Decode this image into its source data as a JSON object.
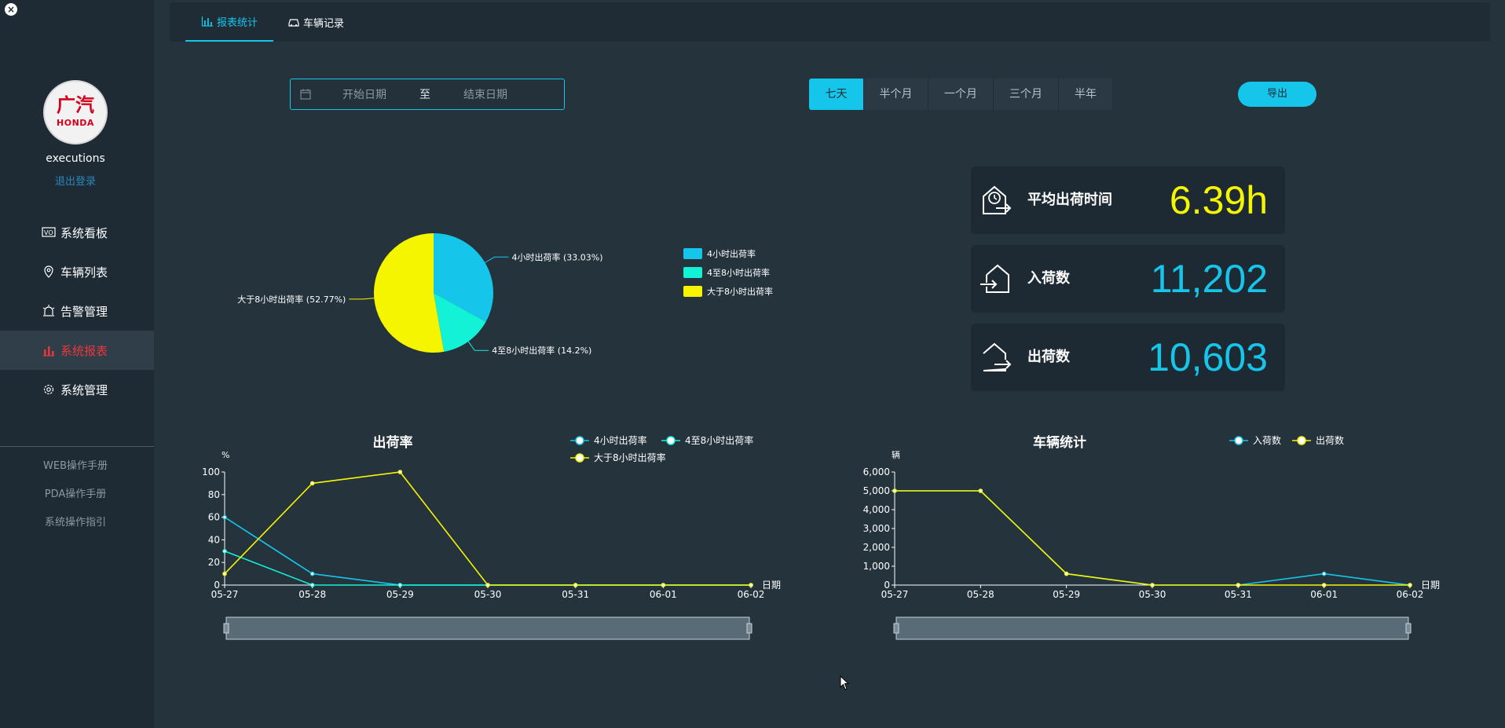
{
  "sidebar": {
    "username": "executions",
    "logout": "退出登录",
    "avatar_logo_top": "广汽",
    "avatar_logo_bottom": "HONDA",
    "menu": [
      {
        "label": "系统看板",
        "icon": "dashboard-icon",
        "active": false
      },
      {
        "label": "车辆列表",
        "icon": "map-pin-icon",
        "active": false
      },
      {
        "label": "告警管理",
        "icon": "alarm-icon",
        "active": false
      },
      {
        "label": "系统报表",
        "icon": "report-icon",
        "active": true
      },
      {
        "label": "系统管理",
        "icon": "gear-icon",
        "active": false
      }
    ],
    "helper_links": [
      "WEB操作手册",
      "PDA操作手册",
      "系统操作指引"
    ]
  },
  "tabs": [
    {
      "label": "报表统计",
      "icon": "bar-chart-icon",
      "active": true
    },
    {
      "label": "车辆记录",
      "icon": "car-icon",
      "active": false
    }
  ],
  "filters": {
    "start_placeholder": "开始日期",
    "separator": "至",
    "end_placeholder": "结束日期",
    "ranges": [
      "七天",
      "半个月",
      "一个月",
      "三个月",
      "半年"
    ],
    "active_range": "七天",
    "export_label": "导出"
  },
  "stats": [
    {
      "label": "平均出荷时间",
      "value": "6.39h",
      "color": "#f5f500",
      "icon": "clock-export-icon"
    },
    {
      "label": "入荷数",
      "value": "11,202",
      "color": "#16c6ea",
      "icon": "inbound-house-icon"
    },
    {
      "label": "出荷数",
      "value": "10,603",
      "color": "#16c6ea",
      "icon": "outbound-house-icon"
    }
  ],
  "colors": {
    "accent": "#16c6ea",
    "series_4h": "#16c6ea",
    "series_4to8h": "#13f1d7",
    "series_8h": "#f5f500",
    "active_menu": "#e8383d"
  },
  "chart_data": [
    {
      "type": "pie",
      "slices": [
        {
          "name": "4小时出荷率",
          "value": 33.03,
          "label": "4小时出荷率 (33.03%)",
          "color": "#16c6ea"
        },
        {
          "name": "4至8小时出荷率",
          "value": 14.2,
          "label": "4至8小时出荷率 (14.2%)",
          "color": "#13f1d7"
        },
        {
          "name": "大于8小时出荷率",
          "value": 52.77,
          "label": "大于8小时出荷率 (52.77%)",
          "color": "#f5f500"
        }
      ],
      "legend": [
        "4小时出荷率",
        "4至8小时出荷率",
        "大于8小时出荷率"
      ],
      "legend_position": "right"
    },
    {
      "type": "line",
      "title": "出荷率",
      "ylabel": "%",
      "xlabel": "日期",
      "ylim": [
        0,
        100
      ],
      "yticks": [
        "0",
        "20",
        "40",
        "60",
        "80",
        "100"
      ],
      "ytick_values": [
        0,
        20,
        40,
        60,
        80,
        100
      ],
      "categories": [
        "05-27",
        "05-28",
        "05-29",
        "05-30",
        "05-31",
        "06-01",
        "06-02"
      ],
      "series": [
        {
          "name": "4小时出荷率",
          "color": "#16c6ea",
          "values": [
            60,
            10,
            0,
            0,
            0,
            0,
            0
          ]
        },
        {
          "name": "4至8小时出荷率",
          "color": "#13f1d7",
          "values": [
            30,
            0,
            0,
            0,
            0,
            0,
            0
          ]
        },
        {
          "name": "大于8小时出荷率",
          "color": "#f5f500",
          "values": [
            10,
            90,
            100,
            0,
            0,
            0,
            0
          ]
        }
      ],
      "legend_position": "top-right"
    },
    {
      "type": "line",
      "title": "车辆统计",
      "ylabel": "辆",
      "xlabel": "日期",
      "ylim": [
        0,
        6000
      ],
      "yticks": [
        "0",
        "1,000",
        "2,000",
        "3,000",
        "4,000",
        "5,000",
        "6,000"
      ],
      "ytick_values": [
        0,
        1000,
        2000,
        3000,
        4000,
        5000,
        6000
      ],
      "categories": [
        "05-27",
        "05-28",
        "05-29",
        "05-30",
        "05-31",
        "06-01",
        "06-02"
      ],
      "series": [
        {
          "name": "入荷数",
          "color": "#16c6ea",
          "values": [
            5000,
            5000,
            600,
            0,
            0,
            600,
            0
          ]
        },
        {
          "name": "出荷数",
          "color": "#f5f500",
          "values": [
            5000,
            5000,
            600,
            0,
            0,
            0,
            0
          ]
        }
      ],
      "legend_position": "top-right"
    }
  ]
}
